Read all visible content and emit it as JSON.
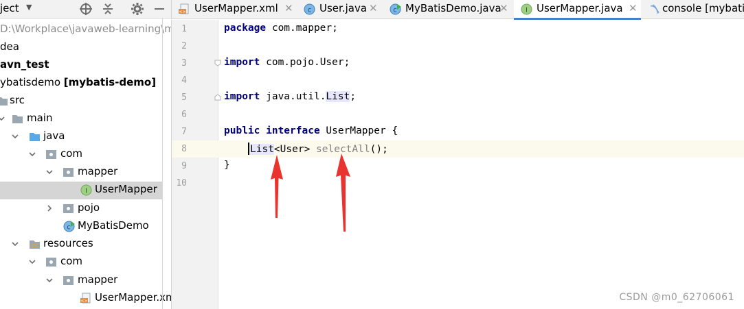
{
  "project": {
    "title": "ject",
    "tree": [
      {
        "label": "D:\\Workplace\\javaweb-learning\\m",
        "style": "gray"
      },
      {
        "label": "dea",
        "style": "normal"
      },
      {
        "label": "avn_test",
        "style": "bold"
      },
      {
        "label": "ybatisdemo ",
        "suffix": "[mybatis-demo]",
        "style": "normal"
      },
      {
        "label": "src",
        "style": "normal"
      },
      {
        "label": "main",
        "style": "normal"
      },
      {
        "label": "java",
        "style": "normal"
      },
      {
        "label": "com",
        "style": "normal"
      },
      {
        "label": "mapper",
        "style": "normal"
      },
      {
        "label": "UserMapper",
        "style": "normal",
        "selected": true
      },
      {
        "label": "pojo",
        "style": "normal"
      },
      {
        "label": "MyBatisDemo",
        "style": "normal"
      },
      {
        "label": "resources",
        "style": "normal"
      },
      {
        "label": "com",
        "style": "normal"
      },
      {
        "label": "mapper",
        "style": "normal"
      },
      {
        "label": "UserMapper.xml",
        "style": "normal"
      }
    ]
  },
  "tabs": [
    {
      "label": "UserMapper.xml",
      "icon": "xml-file-icon"
    },
    {
      "label": "User.java",
      "icon": "class-icon"
    },
    {
      "label": "MyBatisDemo.java",
      "icon": "runnable-class-icon"
    },
    {
      "label": "UserMapper.java",
      "icon": "interface-icon",
      "active": true
    },
    {
      "label": "console [mybatis",
      "icon": "console-icon"
    }
  ],
  "editor": {
    "line_numbers": [
      "1",
      "2",
      "3",
      "4",
      "5",
      "6",
      "7",
      "8",
      "9",
      "10"
    ],
    "current_line": 8,
    "code": {
      "l1_kw": "package",
      "l1_rest": " com.mapper;",
      "l3_kw": "import",
      "l3_rest": " com.pojo.User;",
      "l5_kw": "import",
      "l5_rest": " java.util.",
      "l5_hl": "List",
      "l5_end": ";",
      "l7_kw1": "public",
      "l7_kw2": " interface",
      "l7_rest": " UserMapper {",
      "l8_type": "List",
      "l8_generic": "<User> ",
      "l8_method": "selectAll",
      "l8_end": "();",
      "l9": "}"
    }
  },
  "watermark": "CSDN @m0_62706061",
  "colors": {
    "keyword": "#000080",
    "unused": "#808080",
    "caret_row": "#fcfaed",
    "selection": "#d5d5d5",
    "arrow": "#e8332f",
    "tab_underline": "#4083c9"
  }
}
